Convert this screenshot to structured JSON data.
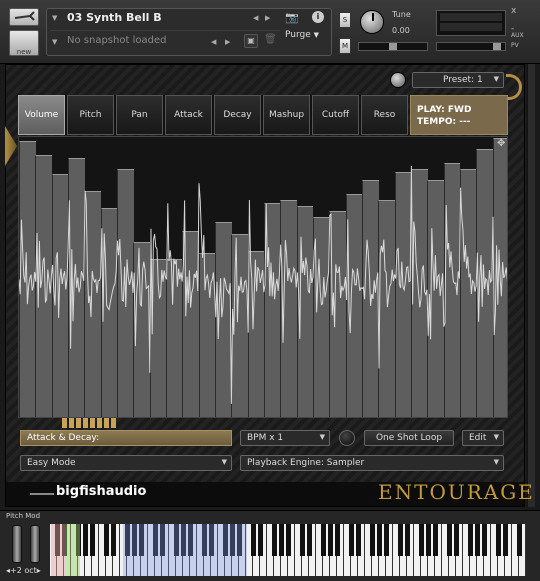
{
  "header": {
    "instrument_name": "03 Synth Bell B",
    "snapshot": "No snapshot loaded",
    "new_label": "new",
    "purge_label": "Purge",
    "tune_label": "Tune",
    "tune_value": "0.00",
    "s_label": "S",
    "m_label": "M",
    "aux_label": "AUX",
    "pv_label": "PV",
    "close_label": "x",
    "minus_label": "-"
  },
  "preset": {
    "label": "Preset: 1"
  },
  "tabs": [
    "Volume",
    "Pitch",
    "Pan",
    "Attack",
    "Decay",
    "Mashup",
    "Cutoff",
    "Reso"
  ],
  "active_tab": "Volume",
  "play_box": {
    "play": "PLAY: FWD",
    "tempo": "TEMPO: ---"
  },
  "step_bars": [
    {
      "level": 0.98
    },
    {
      "level": 0.93
    },
    {
      "level": 0.86
    },
    {
      "level": 0.92
    },
    {
      "level": 0.8
    },
    {
      "level": 0.74
    },
    {
      "level": 0.88
    },
    {
      "level": 0.62
    },
    {
      "level": 0.56
    },
    {
      "level": 0.56
    },
    {
      "level": 0.66
    },
    {
      "level": 0.58
    },
    {
      "level": 0.69
    },
    {
      "level": 0.65
    },
    {
      "level": 0.59
    },
    {
      "level": 0.76
    },
    {
      "level": 0.77
    },
    {
      "level": 0.75
    },
    {
      "level": 0.71
    },
    {
      "level": 0.73
    },
    {
      "level": 0.79
    },
    {
      "level": 0.84
    },
    {
      "level": 0.77
    },
    {
      "level": 0.87
    },
    {
      "level": 0.88
    },
    {
      "level": 0.84
    },
    {
      "level": 0.9
    },
    {
      "level": 0.88
    },
    {
      "level": 0.95
    },
    {
      "level": 0.99
    }
  ],
  "controls": {
    "attack_decay": "Attack & Decay:",
    "bpm": "BPM x 1",
    "one_shot": "One Shot Loop",
    "edit": "Edit",
    "mode": "Easy Mode",
    "engine": "Playback Engine: Sampler"
  },
  "branding": {
    "company": "bigfishaudio",
    "product": "ENTOURAGE"
  },
  "keyboard": {
    "label": "Pitch Mod",
    "octave": "+2 oct"
  },
  "colors": {
    "accent_gold": "#c49a3c",
    "active_tab": "#7a7a7a",
    "bar_fill": "#5e5e5e",
    "play_box": "#7a6a4b"
  }
}
